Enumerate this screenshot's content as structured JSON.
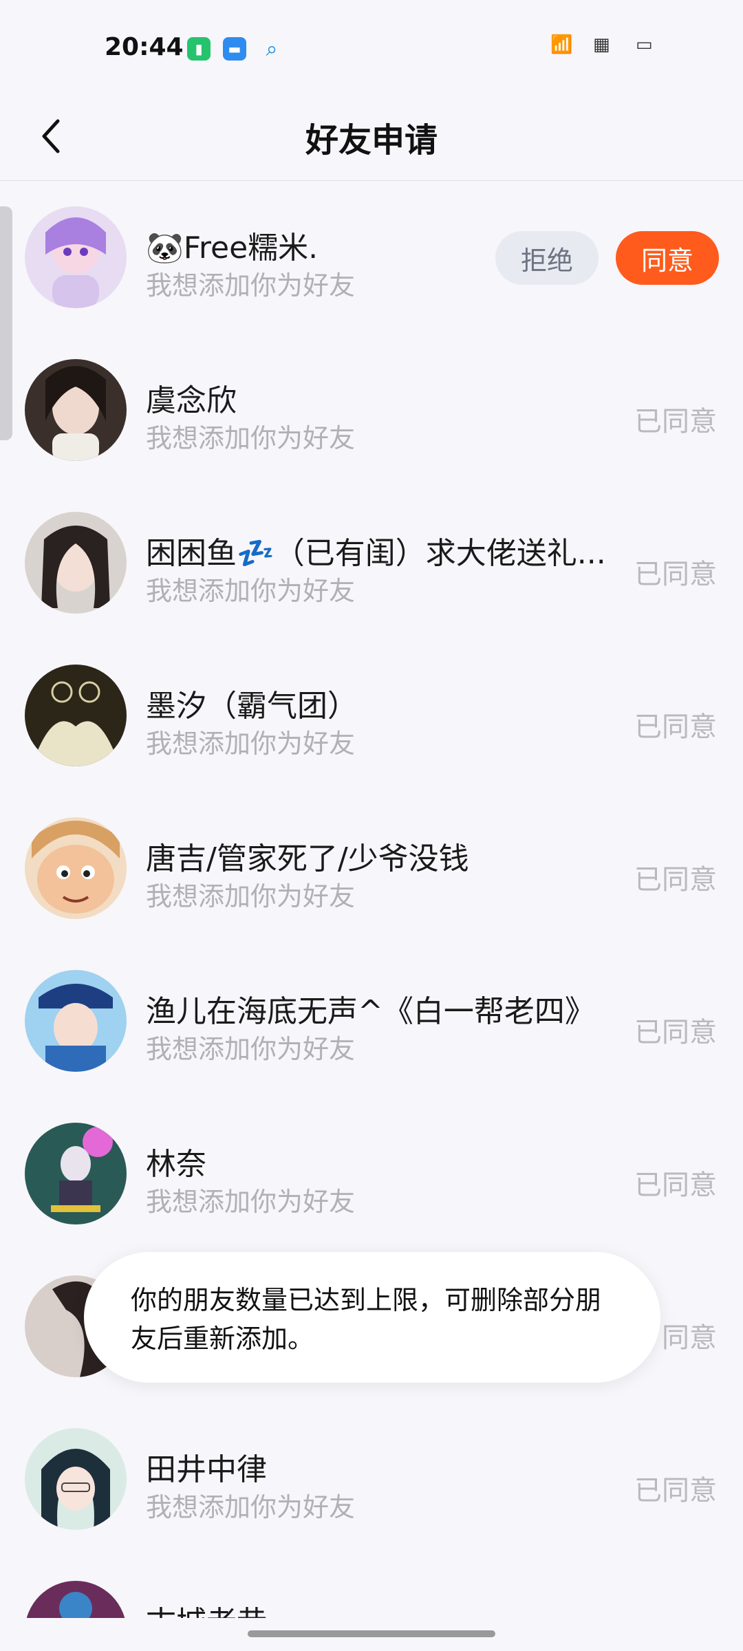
{
  "status_bar": {
    "time": "20:44",
    "right_icons": "ᚷᚷ …ᚷ"
  },
  "header": {
    "title": "好友申请"
  },
  "requests": [
    {
      "name": "🐼Free糯米.",
      "message": "我想添加你为好友",
      "status": "pending"
    },
    {
      "name": "虞念欣",
      "message": "我想添加你为好友",
      "status": "已同意"
    },
    {
      "name": "困困鱼💤（已有闺）求大佬送礼...",
      "message": "我想添加你为好友",
      "status": "已同意"
    },
    {
      "name": "墨汐（霸气团）",
      "message": "我想添加你为好友",
      "status": "已同意"
    },
    {
      "name": "唐吉/管家死了/少爷没钱",
      "message": "我想添加你为好友",
      "status": "已同意"
    },
    {
      "name": "渔儿在海底无声^《白一帮老四》",
      "message": "我想添加你为好友",
      "status": "已同意"
    },
    {
      "name": "林奈",
      "message": "我想添加你为好友",
      "status": "已同意"
    },
    {
      "name": "",
      "message": "",
      "status": "同意"
    },
    {
      "name": "田井中律",
      "message": "我想添加你为好友",
      "status": "已同意"
    },
    {
      "name": "古城老巷",
      "message": "",
      "status": ""
    }
  ],
  "buttons": {
    "reject": "拒绝",
    "accept": "同意"
  },
  "toast": {
    "message": "你的朋友数量已达到上限，可删除部分朋友后重新添加。"
  },
  "colors": {
    "accent": "#ff5b1c",
    "reject_bg": "#e7eaf1",
    "muted_text": "#b0b0b6"
  }
}
